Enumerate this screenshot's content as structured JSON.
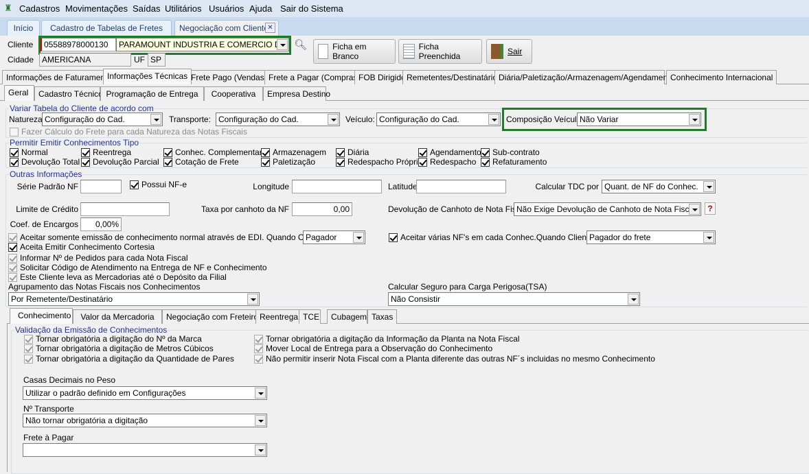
{
  "menu": [
    "Cadastros",
    "Movimentações",
    "Saídas",
    "Utilitários",
    "Usuários",
    "Ajuda",
    "Sair do Sistema"
  ],
  "doc_tabs": [
    "Início",
    "Cadastro de Tabelas de Fretes",
    "Negociação com Cliente"
  ],
  "cliente": {
    "label": "Cliente",
    "code": "05588978000130",
    "name": "PARAMOUNT INDUSTRIA E COMERCIO DE PLAST",
    "cidade_label": "Cidade",
    "cidade": "AMERICANA",
    "uf_label": "UF",
    "uf": "SP"
  },
  "buttons": {
    "blank": "Ficha em Branco",
    "filled": "Ficha Preenchida",
    "exit": "Sair"
  },
  "main_tabs": [
    "Informações de Faturamento",
    "Informações Técnicas",
    "Frete Pago (Vendas)",
    "Frete a Pagar (Compras)",
    "FOB Dirigido",
    "Remetentes/Destinatários",
    "Diária/Paletização/Armazenagem/Agendamento",
    "Conhecimento Internacional"
  ],
  "sub_tabs": [
    "Geral",
    "Cadastro Técnico",
    "Programação de Entrega",
    "Cooperativa",
    "Empresa Destino"
  ],
  "variar": {
    "title": "Variar Tabela do Cliente de acordo com",
    "natureza_label": "Natureza:",
    "natureza": "Configuração do Cad. Empresas",
    "transporte_label": "Transporte:",
    "transporte": "Configuração do Cad. Empresas",
    "veiculo_label": "Veículo:",
    "veiculo": "Configuração do Cad. Empresas",
    "composicao_label": "Composição Veículo",
    "composicao": "Não Variar",
    "fazer_calculo": "Fazer Cálculo do Frete para cada Natureza das Notas Fiscais"
  },
  "permitir": {
    "title": "Permitir Emitir Conhecimentos Tipo",
    "items": [
      "Normal",
      "Reentrega",
      "Conhec. Complementar",
      "Armazenagem",
      "Diária",
      "Agendamento",
      "Sub-contrato",
      "Devolução Total",
      "Devolução Parcial",
      "Cotação de Frete",
      "Paletização",
      "Redespacho Próprio",
      "Redespacho",
      "Refaturamento"
    ]
  },
  "outras": {
    "title": "Outras Informações",
    "serie_label": "Série Padrão NF",
    "serie": "",
    "possui_nfe": "Possui NF-e",
    "longitude_label": "Longitude",
    "longitude": "",
    "latitude_label": "Latitude",
    "latitude": "",
    "tdc_label": "Calcular TDC por",
    "tdc": "Quant. de NF do Conhec.",
    "limite_label": "Limite de Crédito",
    "limite": "",
    "taxa_label": "Taxa por canhoto da NF",
    "taxa": "0,00",
    "devolucao_label": "Devolução de Canhoto de Nota Fiscal",
    "devolucao": "Não Exige Devolução de Canhoto de Nota Fiscal",
    "coef_label": "Coef. de Encargos",
    "coef": "0,00%",
    "edi": "Aceitar somente emissão de conhecimento normal através de EDI. Quando Cliente for",
    "edi_value": "Pagador",
    "varias": "Aceitar várias NF's em cada Conhec.Quando Cliente for",
    "varias_value": "Pagador do frete",
    "cortesia": "Aceita Emitir Conhecimento Cortesia",
    "pedidos": "Informar Nº de Pedidos para cada Nota Fiscal",
    "codigo": "Solicitar Código de Atendimento na Entrega de NF e Conhecimento",
    "deposito": "Este Cliente leva as Mercadorias até o Depósito da Filial",
    "agrup_label": "Agrupamento das Notas Fiscais nos Conhecimentos",
    "agrup": "Por Remetente/Destinatário",
    "seguro_label": "Calcular Seguro para Carga Perigosa(TSA)",
    "seguro": "Não Consistir"
  },
  "inner_tabs": [
    "Conhecimento",
    "Valor da Mercadoria",
    "Negociação com Freteiros",
    "Reentrega",
    "TCE",
    "Cubagem",
    "Taxas"
  ],
  "validacao": {
    "title": "Validação da Emissão de Conhecimentos",
    "items": [
      "Tornar obrigatória a digitação do Nº da Marca",
      "Tornar obrigatória a digitação de Metros Cúbicos",
      "Tornar obrigatória a digitação da Quantidade de Pares",
      "Tornar obrigatória a digitação da Informação da Planta na Nota Fiscal",
      "Mover Local de Entrega para a Observação do Conhecimento",
      "Não permitir inserir Nota Fiscal com a Planta diferente das outras NF´s  incluidas no mesmo Conhecimento"
    ],
    "casas_label": "Casas Decimais no Peso",
    "casas": "Utilizar o padrão definido em Configurações",
    "transporte_label": "Nº Transporte",
    "transporte": "Não tornar obrigatória a digitação",
    "frete_label": "Frete à Pagar",
    "frete": ""
  },
  "colors": {
    "highlight_border": "#1f7a2e",
    "group_title": "#1e2fa0",
    "help": "#d00000"
  }
}
